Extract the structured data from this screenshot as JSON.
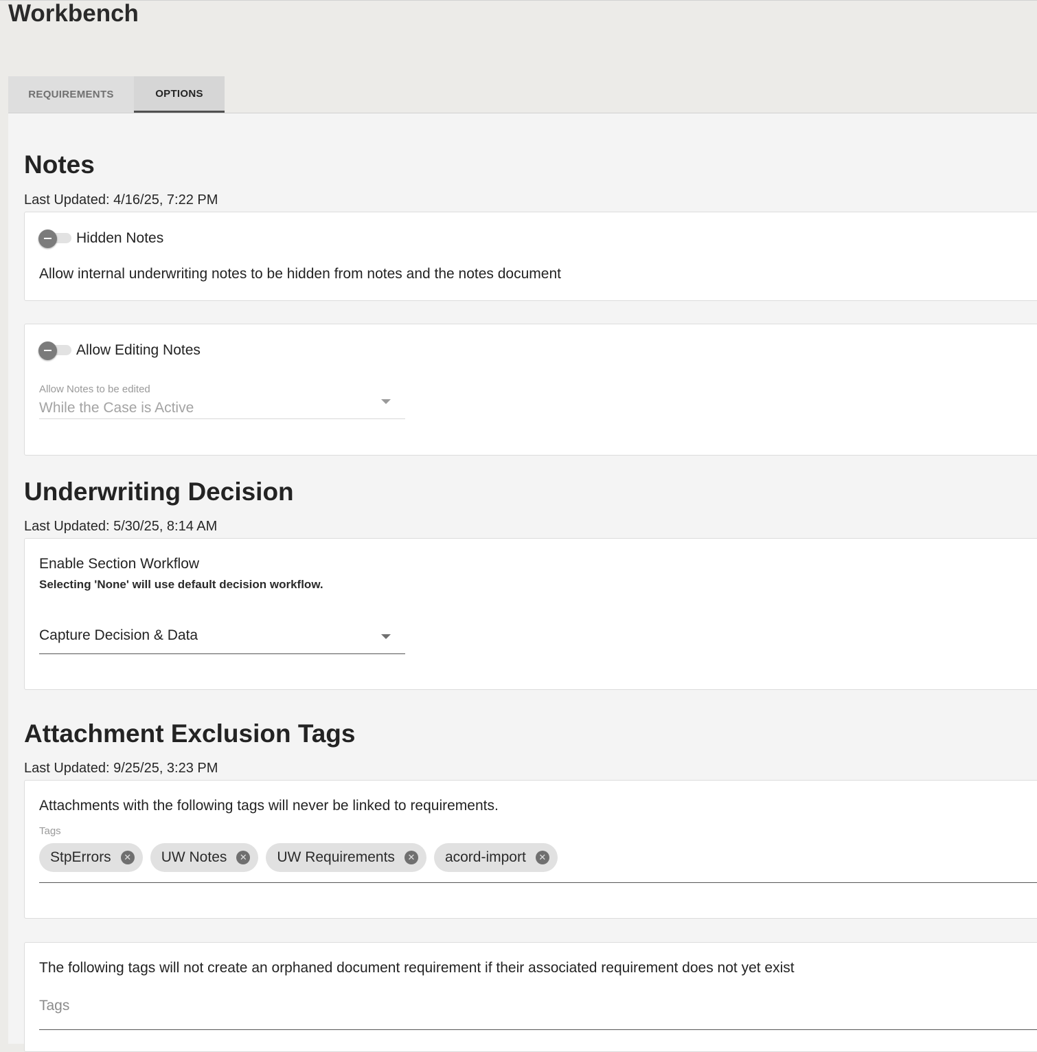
{
  "app": {
    "title": "Workbench"
  },
  "tabs": [
    {
      "label": "REQUIREMENTS",
      "active": false
    },
    {
      "label": "OPTIONS",
      "active": true
    }
  ],
  "notes": {
    "title": "Notes",
    "last_updated": "Last Updated: 4/16/25, 7:22 PM",
    "hidden_notes": {
      "label": "Hidden Notes",
      "enabled": false,
      "description": "Allow internal underwriting notes to be hidden from notes and the notes document"
    },
    "allow_editing": {
      "label": "Allow Editing Notes",
      "enabled": false,
      "select_label": "Allow Notes to be edited",
      "select_value": "While the Case is Active"
    }
  },
  "underwriting": {
    "title": "Underwriting Decision",
    "last_updated": "Last Updated: 5/30/25, 8:14 AM",
    "workflow_label": "Enable Section Workflow",
    "workflow_hint": "Selecting 'None' will use default decision workflow.",
    "workflow_value": "Capture Decision & Data"
  },
  "attachments": {
    "title": "Attachment Exclusion Tags",
    "last_updated": "Last Updated: 9/25/25, 3:23 PM",
    "description": "Attachments with the following tags will never be linked to requirements.",
    "tags_label": "Tags",
    "tags": [
      "StpErrors",
      "UW Notes",
      "UW Requirements",
      "acord-import"
    ],
    "orphan_description": "The following tags will not create an orphaned document requirement if their associated requirement does not yet exist",
    "orphan_tags_placeholder": "Tags"
  },
  "colors": {
    "accent": "#505050",
    "disabled_text": "#9a9a9a",
    "chip_bg": "#e1e1e1",
    "toggle_knob": "#7b7b7b"
  }
}
